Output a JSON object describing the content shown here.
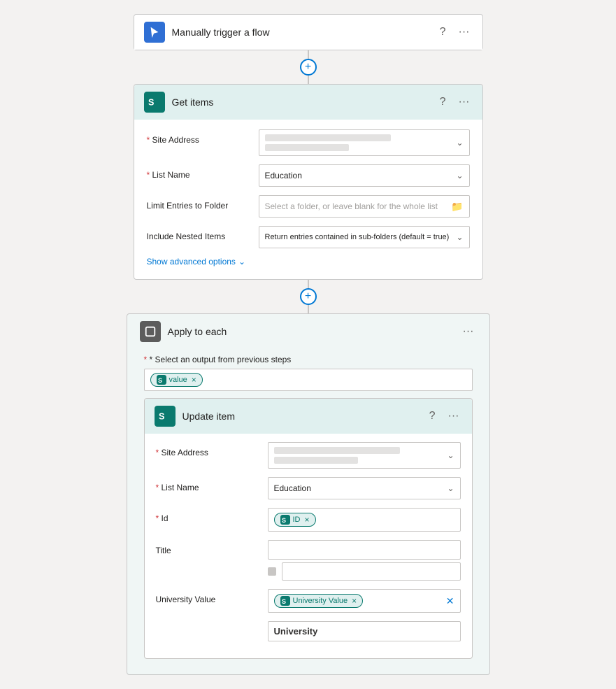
{
  "trigger": {
    "title": "Manually trigger a flow",
    "icon": "cursor-icon",
    "iconBg": "blue"
  },
  "connector1": {
    "plusLabel": "+"
  },
  "getItems": {
    "title": "Get items",
    "iconBg": "teal",
    "siteAddressLabel": "* Site Address",
    "siteAddressBlurred1": "blurred line 1",
    "siteAddressBlurred2": "blurred line 2",
    "listNameLabel": "* List Name",
    "listNameValue": "Education",
    "limitFolderLabel": "Limit Entries to Folder",
    "limitFolderPlaceholder": "Select a folder, or leave blank for the whole list",
    "nestedItemsLabel": "Include Nested Items",
    "nestedItemsValue": "Return entries contained in sub-folders (default = true)",
    "showAdvancedLabel": "Show advanced options",
    "helpIcon": "?",
    "moreIcon": "..."
  },
  "connector2": {
    "plusLabel": "+"
  },
  "applyToEach": {
    "title": "Apply to each",
    "iconBg": "gray",
    "selectOutputLabel": "* Select an output from previous steps",
    "valueToken": "value",
    "moreIcon": "...",
    "updateItem": {
      "title": "Update item",
      "iconBg": "teal",
      "helpIcon": "?",
      "moreIcon": "...",
      "siteAddressLabel": "* Site Address",
      "siteAddressBlurred1": "blurred address line 1",
      "siteAddressBlurred2": "blurred address line 2",
      "listNameLabel": "* List Name",
      "listNameValue": "Education",
      "idLabel": "* Id",
      "idTokenLabel": "ID",
      "titleLabel": "Title",
      "universityValueLabel": "University Value",
      "universityValueToken": "University Value",
      "universityBottomLabel": "University"
    }
  }
}
